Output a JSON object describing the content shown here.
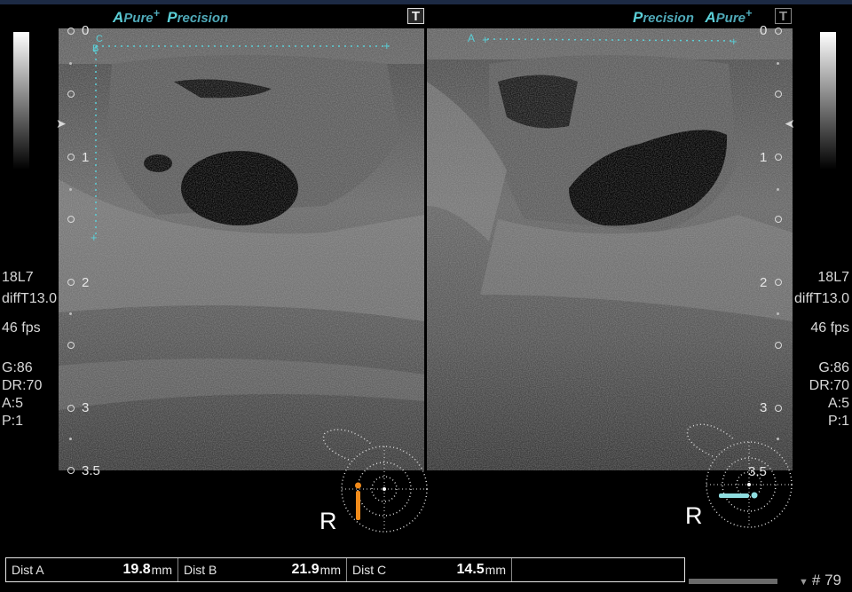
{
  "header": {
    "left": {
      "apure_A": "A",
      "apure": "Pure",
      "apure_plus": "+",
      "precision_P": "P",
      "precision": "recision"
    },
    "right": {
      "precision_P": "P",
      "precision": "recision",
      "apure_A": "A",
      "apure": "Pure",
      "apure_plus": "+"
    },
    "t_icon": "T"
  },
  "depth_scale": {
    "left": [
      "0",
      "1",
      "2",
      "3",
      "3.5"
    ],
    "right": [
      "0",
      "1",
      "2",
      "3",
      "3.5"
    ]
  },
  "left_panel": {
    "transducer": "18L7",
    "filter": "diffT13.0",
    "fps": "46 fps",
    "gain": "G:86",
    "dynamic_range": "DR:70",
    "a_value": "A:5",
    "p_value": "P:1"
  },
  "right_panel": {
    "transducer": "18L7",
    "filter": "diffT13.0",
    "fps": "46 fps",
    "gain": "G:86",
    "dynamic_range": "DR:70",
    "a_value": "A:5",
    "p_value": "P:1"
  },
  "caliper_labels": {
    "c": "C",
    "b": "B",
    "a": "A"
  },
  "body_marker": {
    "left_side": "R",
    "right_side": "R",
    "right_depth": "3.5"
  },
  "measurements": [
    {
      "label": "Dist A",
      "value": "19.8",
      "unit": "mm"
    },
    {
      "label": "Dist B",
      "value": "21.9",
      "unit": "mm"
    },
    {
      "label": "Dist C",
      "value": "14.5",
      "unit": "mm"
    }
  ],
  "frame_number": "# 79",
  "colors": {
    "accent": "#4fa9b8",
    "caliper": "#5bd0d8",
    "probe_left": "#f08a1a",
    "probe_right": "#8fdde0"
  }
}
